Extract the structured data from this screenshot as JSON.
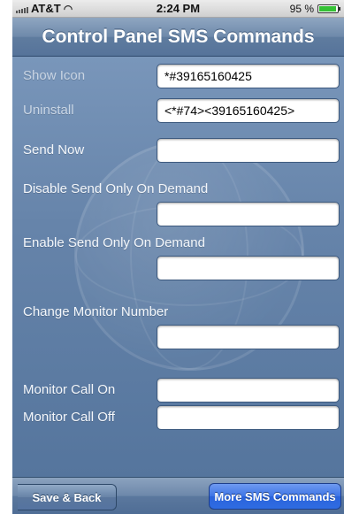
{
  "status_bar": {
    "carrier": "AT&T",
    "time": "2:24 PM",
    "battery_percent_label": "95 %",
    "battery_level": 0.95,
    "wifi_icon": "wifi-icon",
    "signal_icon": "signal-bars-icon"
  },
  "nav": {
    "title": "Control Panel SMS Commands"
  },
  "commands": {
    "show_icon": {
      "label": "Show Icon",
      "value": "*#39165160425"
    },
    "uninstall": {
      "label": "Uninstall",
      "value": "<*#74><39165160425>"
    },
    "send_now": {
      "label": "Send Now",
      "value": ""
    },
    "disable_send_on_demand": {
      "label": "Disable Send Only On Demand",
      "value": ""
    },
    "enable_send_on_demand": {
      "label": "Enable Send Only On Demand",
      "value": ""
    },
    "change_monitor_number": {
      "label": "Change Monitor Number",
      "value": ""
    },
    "monitor_call_on": {
      "label": "Monitor Call On",
      "value": ""
    },
    "monitor_call_off": {
      "label": "Monitor Call Off",
      "value": ""
    }
  },
  "toolbar": {
    "back_label": "Save & Back",
    "more_label": "More SMS Commands"
  },
  "colors": {
    "nav_bar": "#6e89aa",
    "content_bg": "#6684aa",
    "more_button": "#3d74e6",
    "battery_fill": "#35c135"
  }
}
